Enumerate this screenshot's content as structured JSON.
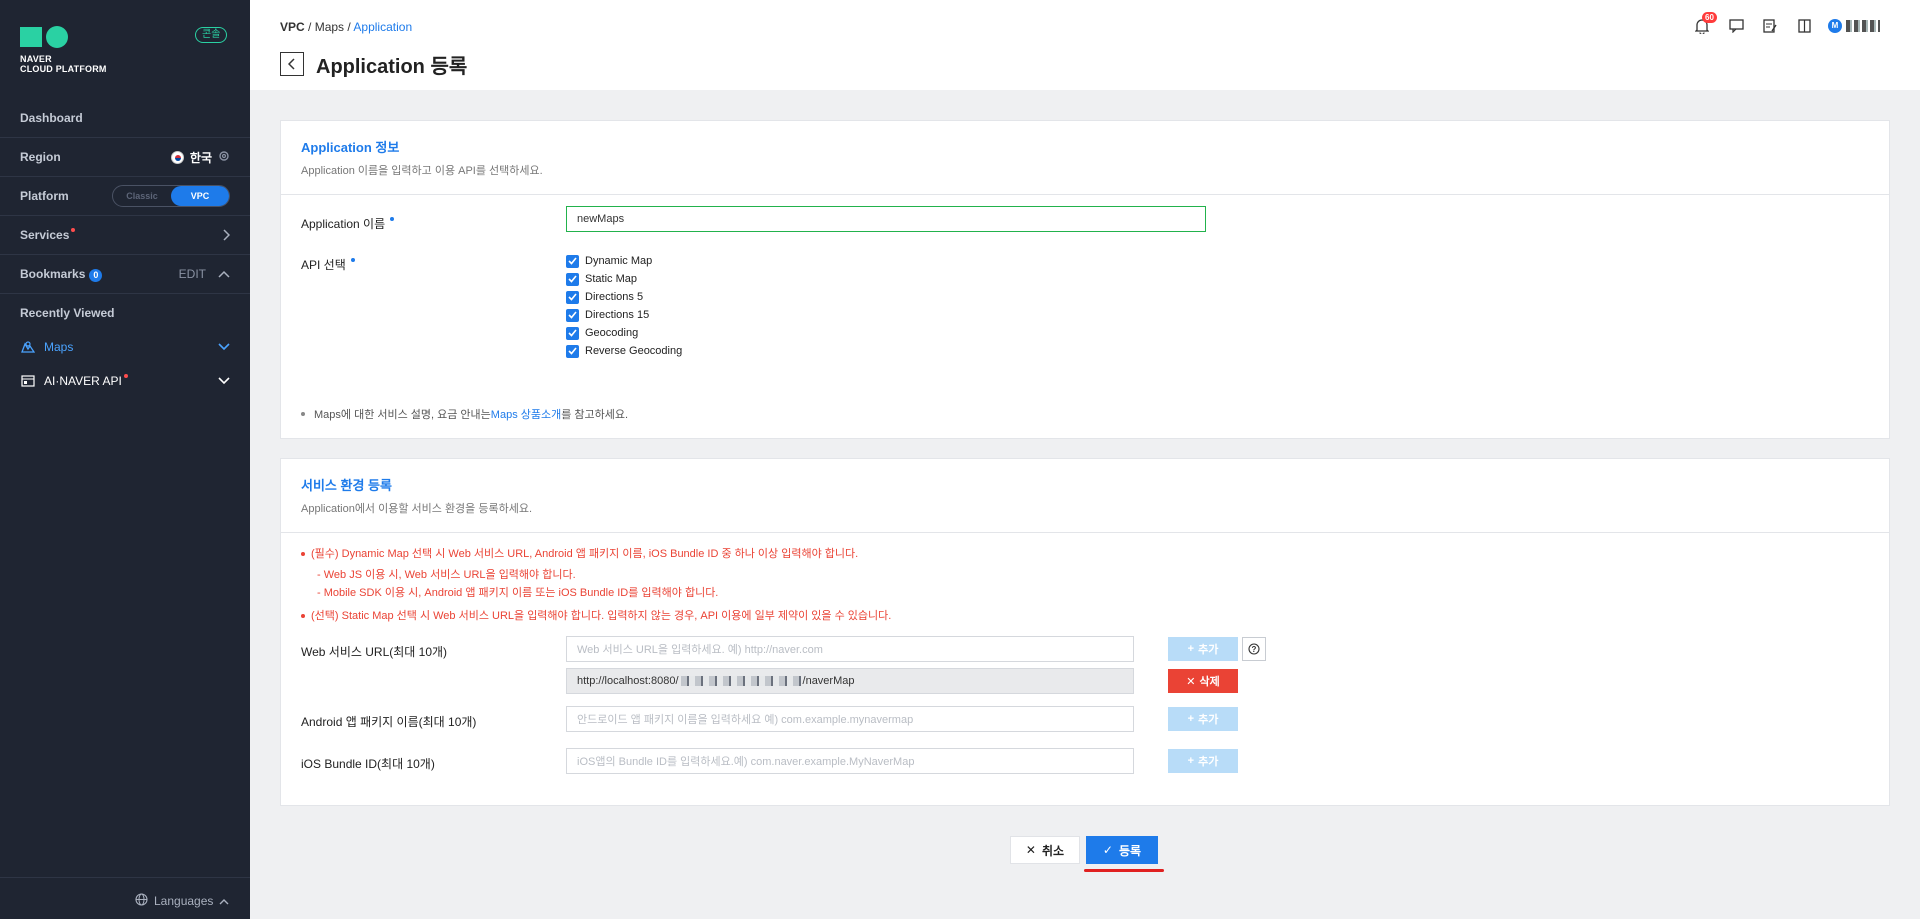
{
  "sidebar": {
    "brand_line1": "NAVER",
    "brand_line2": "CLOUD PLATFORM",
    "badge": "콘솔",
    "dashboard": "Dashboard",
    "region_label": "Region",
    "region_value": "한국",
    "platform_label": "Platform",
    "platform_options": [
      "Classic",
      "VPC"
    ],
    "services_label": "Services",
    "bookmarks_label": "Bookmarks",
    "bookmarks_count": "0",
    "bookmarks_edit": "EDIT",
    "recently_viewed": "Recently Viewed",
    "recent_items": [
      {
        "label": "Maps",
        "icon": "maps-icon"
      },
      {
        "label": "AI·NAVER API",
        "icon": "api-icon"
      }
    ],
    "languages": "Languages"
  },
  "header": {
    "breadcrumb": [
      "VPC",
      "Maps",
      "Application"
    ],
    "title": "Application 등록",
    "notif_count": "60",
    "avatar_letter": "M"
  },
  "app_info": {
    "title": "Application 정보",
    "desc": "Application 이름을 입력하고 이용 API를 선택하세요.",
    "name_label": "Application 이름",
    "name_value": "newMaps",
    "api_label": "API 선택",
    "apis": [
      "Dynamic Map",
      "Static Map",
      "Directions 5",
      "Directions 15",
      "Geocoding",
      "Reverse Geocoding"
    ],
    "note_prefix": "Maps에 대한 서비스 설명, 요금 안내는 ",
    "note_link": "Maps 상품소개",
    "note_suffix": "를 참고하세요."
  },
  "service_env": {
    "title": "서비스 환경 등록",
    "desc": "Application에서 이용할 서비스 환경을 등록하세요.",
    "warn1": "(필수) Dynamic Map 선택 시 Web 서비스 URL, Android 앱 패키지 이름, iOS Bundle ID 중 하나 이상 입력해야 합니다.",
    "warn1a": "- Web JS 이용 시, Web 서비스 URL을 입력해야 합니다.",
    "warn1b": "- Mobile SDK 이용 시, Android 앱 패키지 이름 또는 iOS Bundle ID를 입력해야 합니다.",
    "warn2": "(선택) Static Map 선택 시 Web 서비스 URL을 입력해야 합니다. 입력하지 않는 경우, API 이용에 일부 제약이 있을 수 있습니다.",
    "web_label": "Web 서비스 URL(최대 10개)",
    "web_placeholder": "Web 서비스 URL을 입력하세요. 예) http://naver.com",
    "web_url_prefix": "http://localhost:8080/",
    "web_url_suffix": "/naverMap",
    "android_label": "Android 앱 패키지 이름(최대 10개)",
    "android_placeholder": "안드로이드 앱 패키지 이름을 입력하세요 예) com.example.mynavermap",
    "ios_label": "iOS Bundle ID(최대 10개)",
    "ios_placeholder": "iOS앱의 Bundle ID를 입력하세요.예) com.naver.example.MyNaverMap",
    "add_label": "추가",
    "delete_label": "삭제"
  },
  "footer": {
    "cancel": "취소",
    "submit": "등록"
  },
  "colors": {
    "accent": "#1e7bea",
    "sidebar_bg": "#1f2532",
    "brand_green": "#2ad1a3",
    "danger": "#ea4335"
  }
}
